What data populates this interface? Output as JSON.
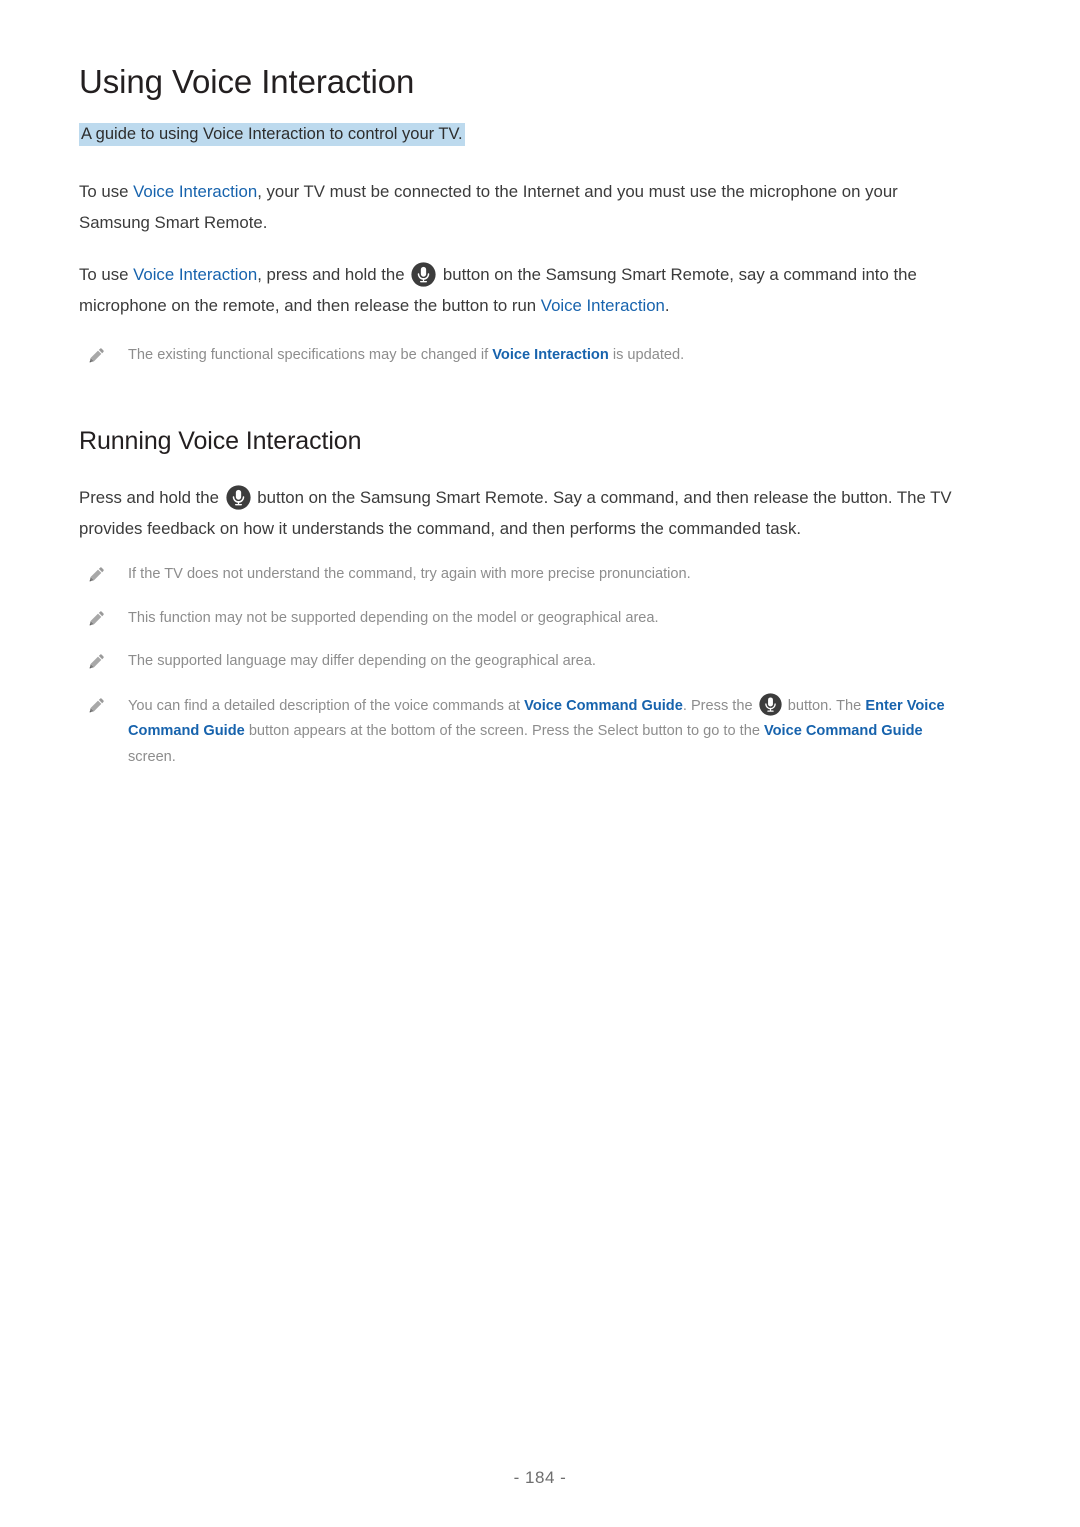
{
  "document": {
    "title": "Using Voice Interaction",
    "page_number": "- 184 -"
  },
  "colors": {
    "highlight": "#bddaee",
    "link_blue": "#1763ad",
    "body_text": "#3b3b3b",
    "note_text": "#8d8d8d",
    "heading": "#231f20",
    "mic_badge": "#3c3c3c"
  },
  "sections": {
    "intro": {
      "heading": "Using Voice Interaction",
      "lead": "A guide to using Voice Interaction to control your TV.",
      "paragraph1": {
        "part1": "To use ",
        "link1": "Voice Interaction",
        "part2": ", your TV must be connected to the Internet and you must use the microphone on your Samsung Smart Remote."
      },
      "paragraph2": {
        "part1": "To use ",
        "link1": "Voice Interaction",
        "part2": ", press and hold the ",
        "icon1": "microphone-icon",
        "part3": " button on the Samsung Smart Remote, say a command into the microphone on the remote, and then release the button to run ",
        "link2": "Voice Interaction",
        "part4": "."
      },
      "note1": {
        "icon": "pencil-icon",
        "part1": "The existing functional specifications may be changed if ",
        "link1": "Voice Interaction",
        "part2": " is updated."
      }
    },
    "running": {
      "heading": "Running Voice Interaction",
      "paragraph1": {
        "part1": "Press and hold the ",
        "icon1": "microphone-icon",
        "part2": " button on the Samsung Smart Remote. Say a command, and then release the button. The TV provides feedback on how it understands the command, and then performs the commanded task."
      },
      "notes": [
        {
          "icon": "pencil-icon",
          "text": "If the TV does not understand the command, try again with more precise pronunciation."
        },
        {
          "icon": "pencil-icon",
          "text": "This function may not be supported depending on the model or geographical area."
        },
        {
          "icon": "pencil-icon",
          "text": "The supported language may differ depending on the geographical area."
        }
      ],
      "note_detail": {
        "icon": "pencil-icon",
        "part1": "You can find a detailed description of the voice commands at ",
        "link1": "Voice Command Guide",
        "part2": ". Press the ",
        "icon1": "microphone-icon",
        "part3": " button. The ",
        "link2": "Enter Voice Command Guide",
        "part4": " button appears at the bottom of the screen. Press the Select button to go to the ",
        "link3": "Voice Command Guide",
        "part5": " screen."
      }
    }
  }
}
